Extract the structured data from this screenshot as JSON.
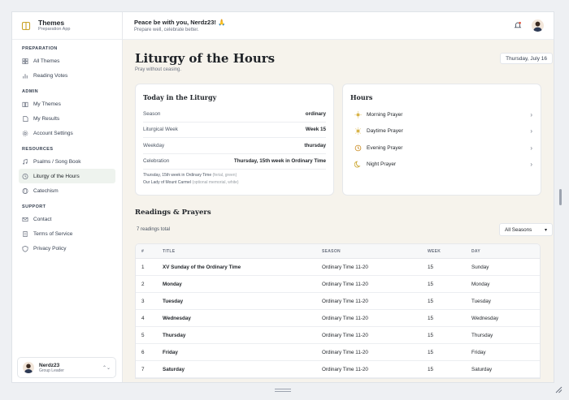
{
  "app": {
    "name": "Themes",
    "subtitle": "Preparation App"
  },
  "sidebar": {
    "groups": [
      {
        "title": "PREPARATION",
        "items": [
          {
            "label": "All Themes",
            "icon": "grid-icon"
          },
          {
            "label": "Reading Votes",
            "icon": "bar-chart-icon"
          }
        ]
      },
      {
        "title": "ADMIN",
        "items": [
          {
            "label": "My Themes",
            "icon": "book-icon"
          },
          {
            "label": "My Results",
            "icon": "file-icon"
          },
          {
            "label": "Account Settings",
            "icon": "gear-icon"
          }
        ]
      },
      {
        "title": "RESOURCES",
        "items": [
          {
            "label": "Psalms / Song Book",
            "icon": "music-icon"
          },
          {
            "label": "Liturgy of the Hours",
            "icon": "clock-icon",
            "active": true
          },
          {
            "label": "Catechism",
            "icon": "globe-icon"
          }
        ]
      },
      {
        "title": "SUPPORT",
        "items": [
          {
            "label": "Contact",
            "icon": "mail-icon"
          },
          {
            "label": "Terms of Service",
            "icon": "document-icon"
          },
          {
            "label": "Privacy Policy",
            "icon": "shield-icon"
          }
        ]
      }
    ],
    "user": {
      "name": "Nerdz23",
      "role": "Group Leader"
    }
  },
  "topbar": {
    "greeting": "Peace be with you, Nerdz23! 🙏",
    "subtitle": "Prepare well, celebrate better."
  },
  "page": {
    "title": "Liturgy of the Hours",
    "subtitle": "Pray without ceasing.",
    "date": "Thursday, July 16"
  },
  "liturgy": {
    "title": "Today in the Liturgy",
    "rows": [
      {
        "key": "Season",
        "value": "ordinary"
      },
      {
        "key": "Liturgical Week",
        "value": "Week 15"
      },
      {
        "key": "Weekday",
        "value": "thursday"
      },
      {
        "key": "Celebration",
        "value": "Thursday, 15th week in Ordinary Time"
      }
    ],
    "notes": [
      {
        "text": "Thursday, 15th week in Ordinary Time",
        "muted": "(ferial, green)"
      },
      {
        "text": "Our Lady of Mount Carmel",
        "muted": "(optional memorial, white)"
      }
    ]
  },
  "hours": {
    "title": "Hours",
    "items": [
      {
        "label": "Morning Prayer",
        "icon": "sunrise-icon",
        "color": "#d9b44a"
      },
      {
        "label": "Daytime Prayer",
        "icon": "sun-icon",
        "color": "#d9b44a"
      },
      {
        "label": "Evening Prayer",
        "icon": "sunset-icon",
        "color": "#c98a1e"
      },
      {
        "label": "Night Prayer",
        "icon": "moon-icon",
        "color": "#c9a227"
      }
    ]
  },
  "readings": {
    "title": "Readings & Prayers",
    "count": "7 readings total",
    "filter": "All Seasons",
    "columns": [
      "#",
      "TITLE",
      "SEASON",
      "WEEK",
      "DAY"
    ],
    "rows": [
      [
        "1",
        "XV Sunday of the Ordinary Time",
        "Ordinary Time 11-20",
        "15",
        "Sunday"
      ],
      [
        "2",
        "Monday",
        "Ordinary Time 11-20",
        "15",
        "Monday"
      ],
      [
        "3",
        "Tuesday",
        "Ordinary Time 11-20",
        "15",
        "Tuesday"
      ],
      [
        "4",
        "Wednesday",
        "Ordinary Time 11-20",
        "15",
        "Wednesday"
      ],
      [
        "5",
        "Thursday",
        "Ordinary Time 11-20",
        "15",
        "Thursday"
      ],
      [
        "6",
        "Friday",
        "Ordinary Time 11-20",
        "15",
        "Friday"
      ],
      [
        "7",
        "Saturday",
        "Ordinary Time 11-20",
        "15",
        "Saturday"
      ]
    ]
  },
  "colors": {
    "accent": "#c9a227",
    "active_bg": "#eef3ee",
    "main_bg": "#f6f3ec",
    "bell": "#e0533d"
  }
}
